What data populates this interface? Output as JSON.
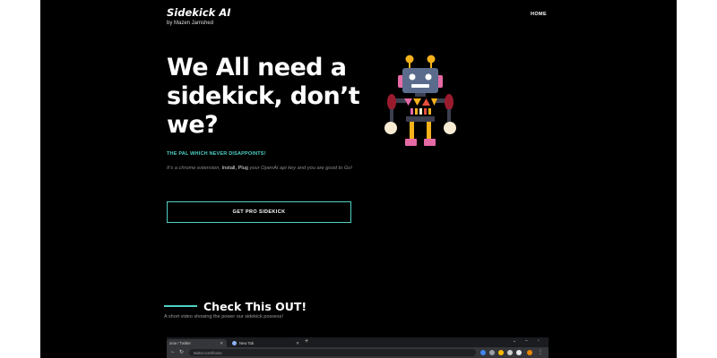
{
  "header": {
    "brand_title": "Sidekick AI",
    "brand_subtitle": "by Mazen Jamshed",
    "nav_home": "HOME"
  },
  "hero": {
    "title_line1": "We All need a",
    "title_line2": "sidekick, don’t",
    "title_line3": "we?",
    "tagline": "THE PAL WHICH NEVER DISAPPOINTS!",
    "desc_part1": "It’s a chrome extension, ",
    "desc_part2": "Install, Plug",
    "desc_part3": " your OpenAI api key and you are good to Go!",
    "cta_label": "GET PRO SIDEKICK"
  },
  "section": {
    "title": "Check This OUT!",
    "subtitle": "A short video showing the power our sidekick possess!"
  },
  "browser": {
    "tab1_label": "ome / Twitter",
    "tab2_label": "New Tab",
    "url": "twitter.com/home"
  },
  "colors": {
    "accent": "#4fd1c5",
    "background": "#000000"
  }
}
